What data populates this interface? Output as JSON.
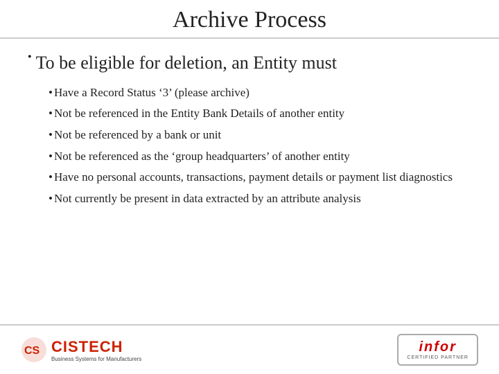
{
  "header": {
    "title": "Archive Process"
  },
  "main": {
    "bullet_label": "•",
    "main_text": "To be eligible for deletion, an Entity must",
    "sub_bullets": [
      {
        "text": "Have a Record Status ‘3’ (please archive)"
      },
      {
        "text": "Not be referenced in the Entity Bank Details of another entity"
      },
      {
        "text": "Not be referenced by a bank or unit"
      },
      {
        "text": "Not be referenced as the ‘group headquarters’ of another entity"
      },
      {
        "text": "Have no personal accounts, transactions, payment details or payment list diagnostics"
      },
      {
        "text": "Not currently be present in data extracted by an attribute analysis"
      }
    ]
  },
  "footer": {
    "cistech_name": "CISTECH",
    "cistech_tagline": "Business Systems for Manufacturers",
    "infor_name": "infor",
    "infor_certified": "CERTIFIED PARTNER"
  }
}
